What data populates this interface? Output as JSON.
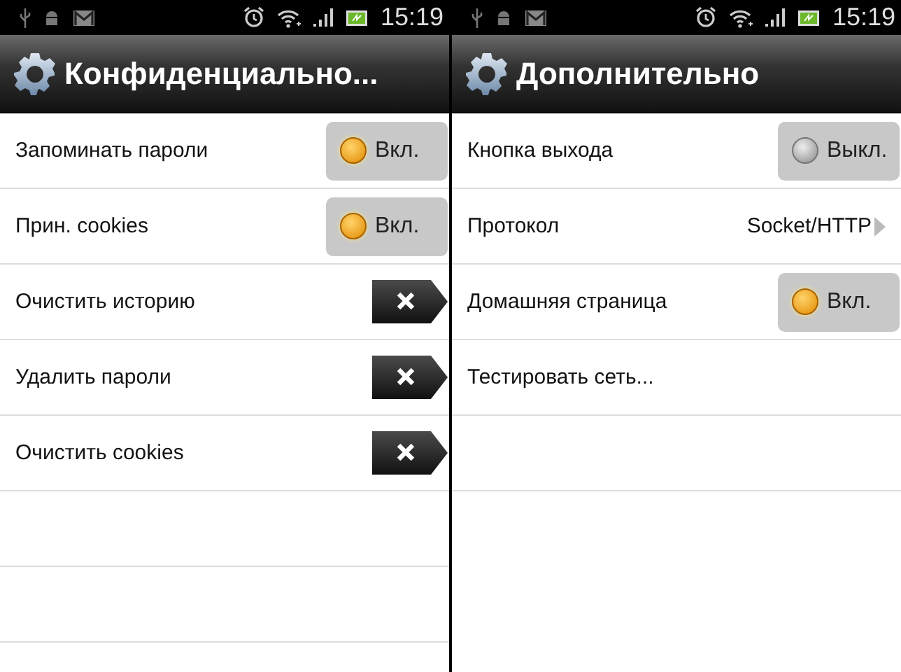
{
  "screens": [
    {
      "status_bar": {
        "time": "15:19"
      },
      "title": "Конфиденциально...",
      "items": [
        {
          "kind": "toggle",
          "label": "Запоминать пароли",
          "on": true,
          "value": "Вкл."
        },
        {
          "kind": "toggle",
          "label": "Прин. cookies",
          "on": true,
          "value": "Вкл."
        },
        {
          "kind": "action",
          "label": "Очистить историю"
        },
        {
          "kind": "action",
          "label": "Удалить пароли"
        },
        {
          "kind": "action",
          "label": "Очистить cookies"
        }
      ]
    },
    {
      "status_bar": {
        "time": "15:19"
      },
      "title": "Дополнительно",
      "items": [
        {
          "kind": "toggle",
          "label": "Кнопка выхода",
          "on": false,
          "value": "Выкл."
        },
        {
          "kind": "choice",
          "label": "Протокол",
          "value": "Socket/HTTP"
        },
        {
          "kind": "toggle",
          "label": "Домашняя страница",
          "on": true,
          "value": "Вкл."
        },
        {
          "kind": "plain",
          "label": "Тестировать сеть..."
        }
      ]
    }
  ]
}
